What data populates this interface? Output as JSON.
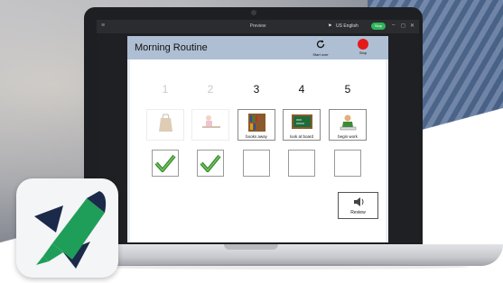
{
  "window": {
    "title": "Preview",
    "language_label": "US English",
    "stop_pill_label": "Stop",
    "menu_glyph": "≡",
    "minimize_glyph": "–",
    "maximize_glyph": "◻",
    "close_glyph": "✕"
  },
  "header": {
    "title": "Morning Routine",
    "start_over_label": "Start over",
    "stop_label": "Stop"
  },
  "steps": [
    {
      "number": "1",
      "caption": "",
      "done": true,
      "picture": "lunch-bag"
    },
    {
      "number": "2",
      "caption": "",
      "done": true,
      "picture": "person-at-desk"
    },
    {
      "number": "3",
      "caption": "books away",
      "done": false,
      "picture": "bookshelf"
    },
    {
      "number": "4",
      "caption": "look at board",
      "done": false,
      "picture": "chalkboard"
    },
    {
      "number": "5",
      "caption": "begin work",
      "done": false,
      "picture": "student-writing"
    }
  ],
  "review_label": "Review",
  "colors": {
    "header_bg": "#aebfd3",
    "stop_red": "#e61919",
    "check_green": "#2f8a2f",
    "pill_green": "#2fb45a",
    "logo_green": "#1f9e5a",
    "logo_navy": "#1b2a4a"
  }
}
